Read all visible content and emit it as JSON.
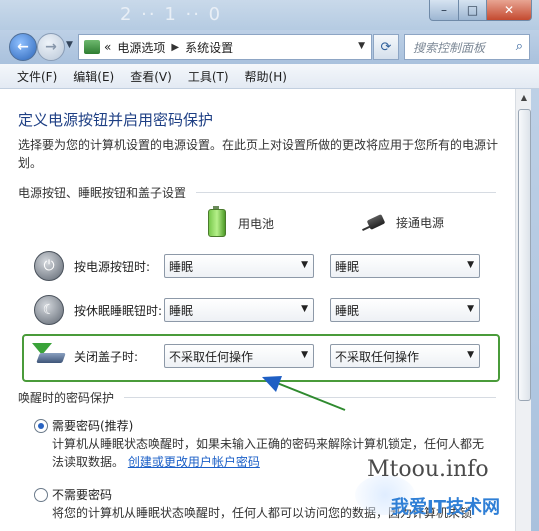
{
  "window": {
    "title_faded": "2 ·· 1 ·· 0",
    "controls": {
      "minimize": "–",
      "maximize": "□",
      "close": "✕"
    }
  },
  "address": {
    "prefix": "«",
    "crumbs": [
      "电源选项",
      "系统设置"
    ],
    "search_placeholder": "搜索控制面板"
  },
  "menu": [
    "文件(F)",
    "编辑(E)",
    "查看(V)",
    "工具(T)",
    "帮助(H)"
  ],
  "page": {
    "title": "定义电源按钮并启用密码保护",
    "description": "选择要为您的计算机设置的电源设置。在此页上对设置所做的更改将应用于您所有的电源计划。"
  },
  "power_section": {
    "heading": "电源按钮、睡眠按钮和盖子设置",
    "columns": {
      "battery": "用电池",
      "plugged": "接通电源"
    },
    "rows": [
      {
        "label": "按电源按钮时:",
        "battery": "睡眠",
        "plugged": "睡眠"
      },
      {
        "label": "按休眠睡眠钮时:",
        "battery": "睡眠",
        "plugged": "睡眠"
      },
      {
        "label": "关闭盖子时:",
        "battery": "不采取任何操作",
        "plugged": "不采取任何操作"
      }
    ]
  },
  "wake_section": {
    "heading": "唤醒时的密码保护",
    "options": [
      {
        "label": "需要密码(推荐)",
        "selected": true,
        "text": "计算机从睡眠状态唤醒时，如果未输入正确的密码来解除计算机锁定，任何人都无法读取数据。",
        "link": "创建或更改用户帐户密码"
      },
      {
        "label": "不需要密码",
        "selected": false,
        "text": "将您的计算机从睡眠状态唤醒时，任何人都可以访问您的数据，因为计算机未锁"
      }
    ]
  },
  "watermark": {
    "main": "Mtoou.info",
    "sub": "我爱IT技术网"
  },
  "colors": {
    "title": "#1e3f84",
    "highlight": "#4a9b3a",
    "link": "#1a5fc7"
  }
}
